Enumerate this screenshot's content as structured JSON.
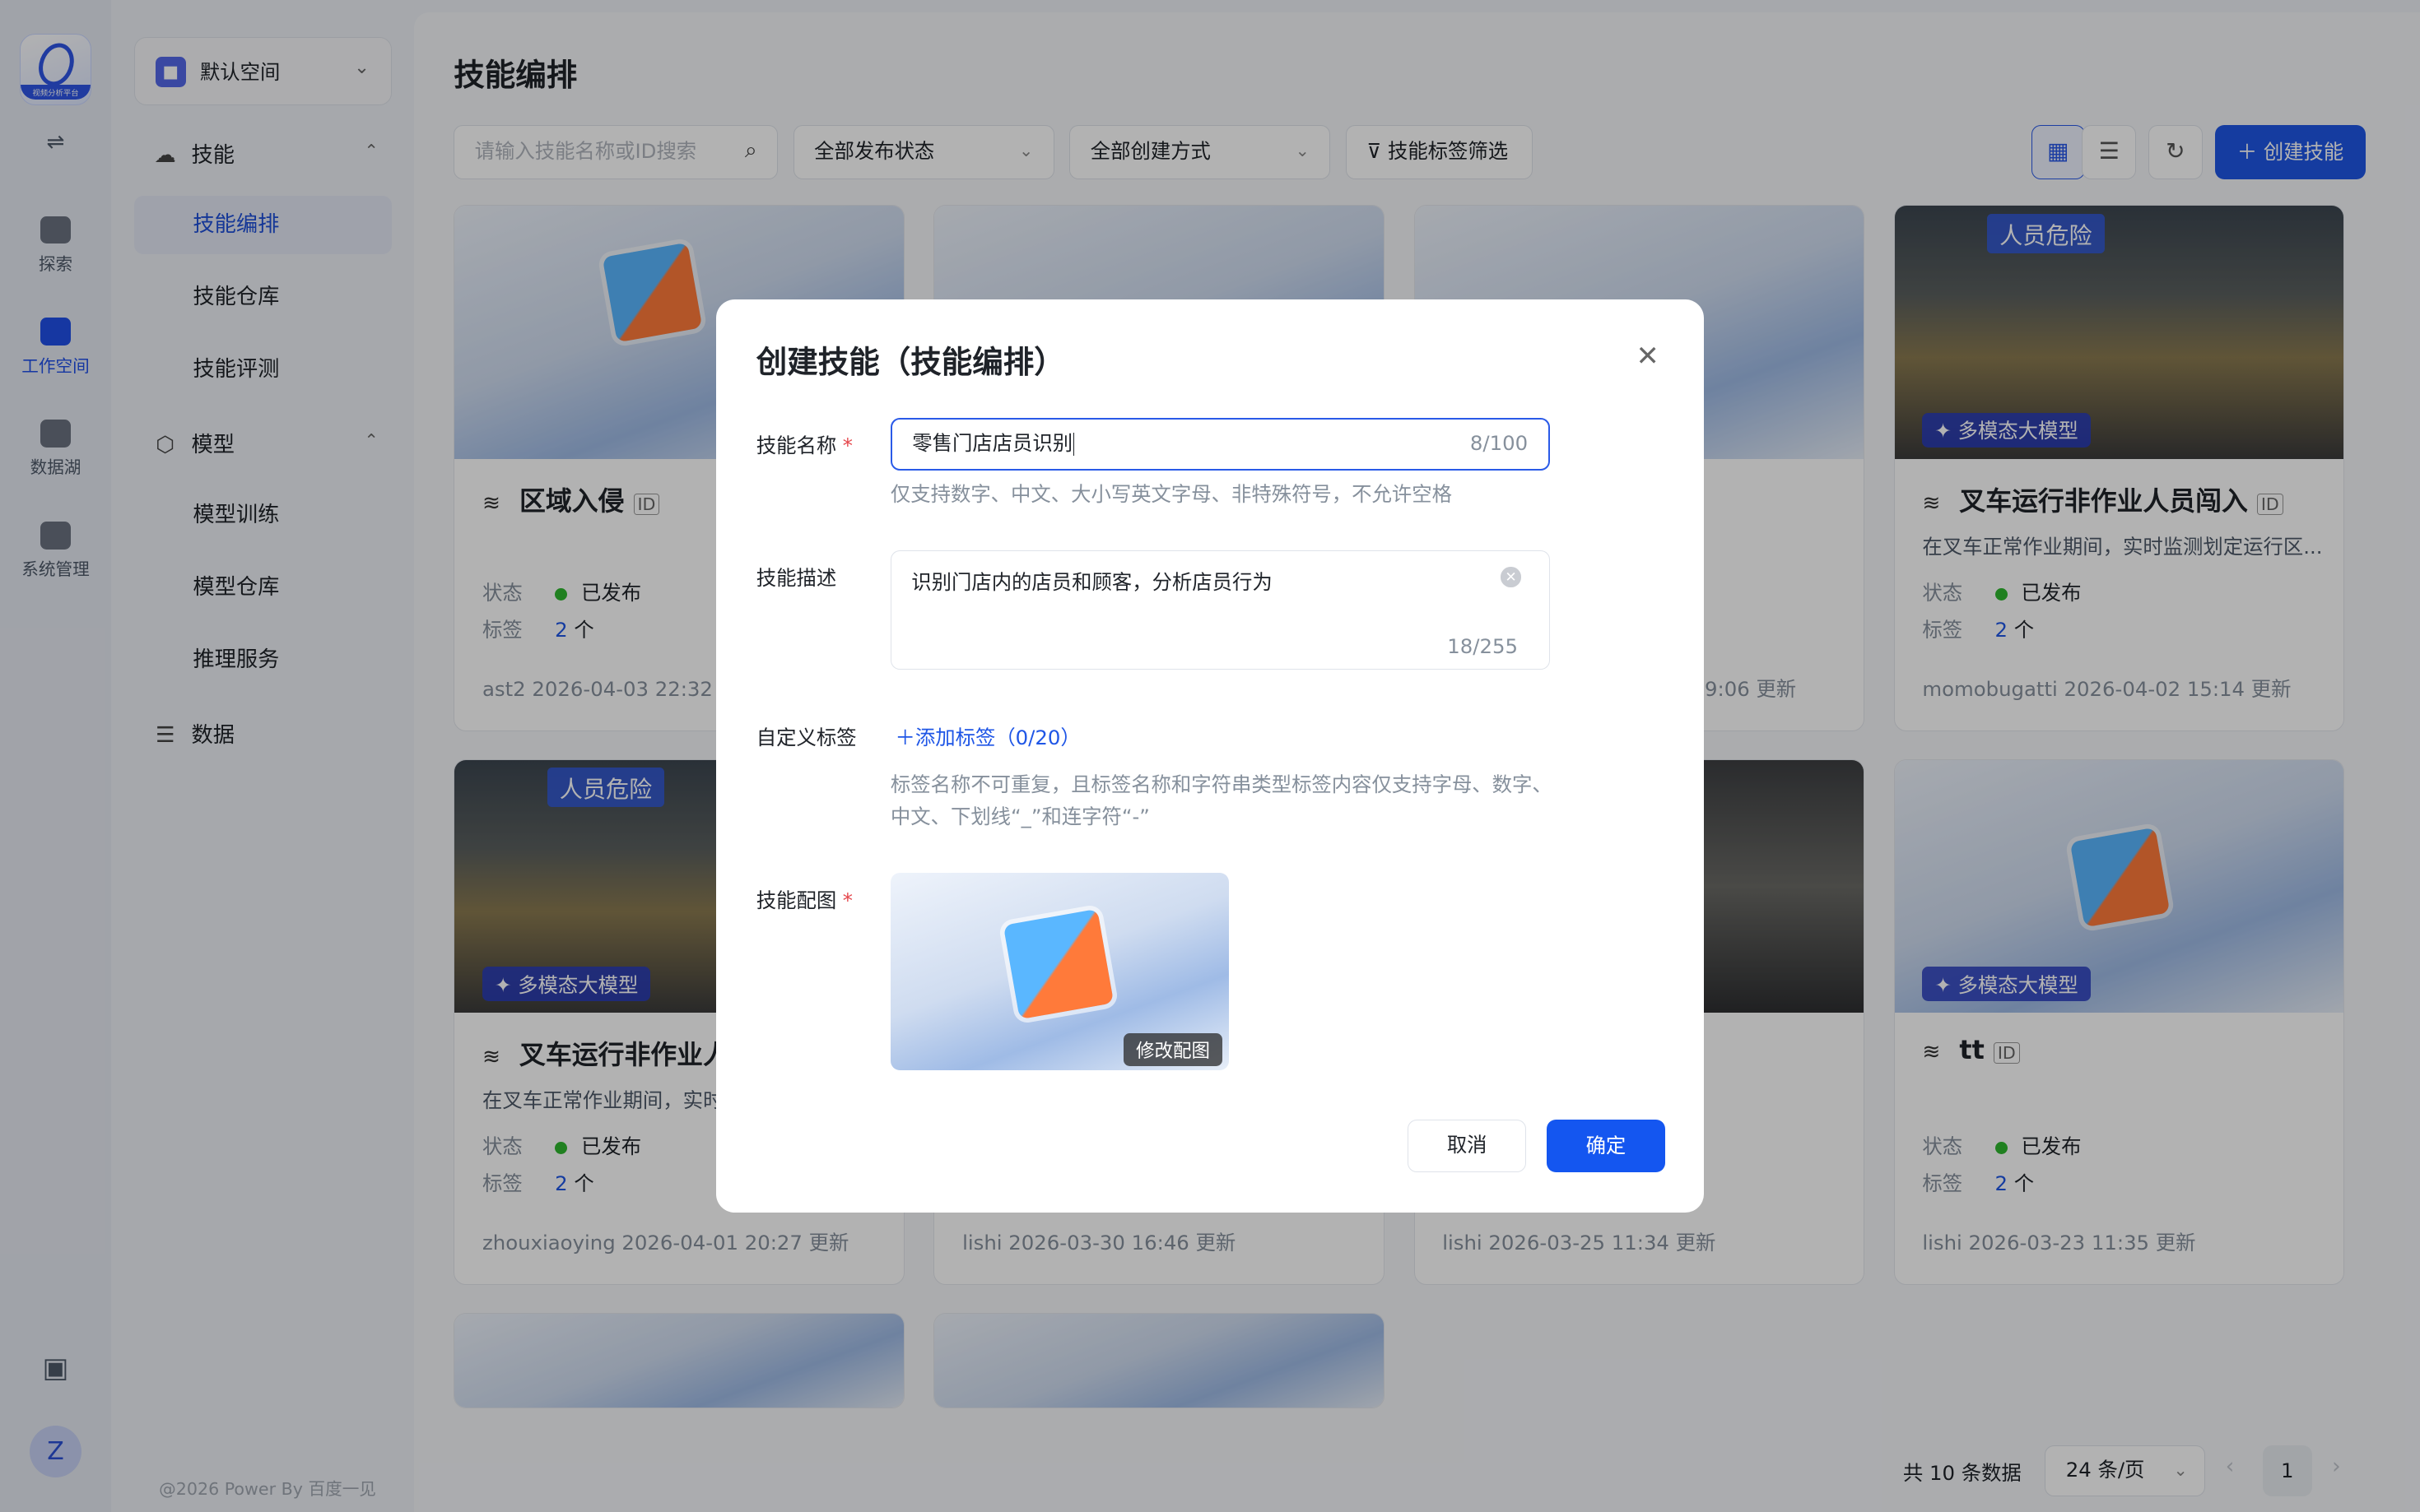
{
  "rail": {
    "logo_caption": "视频分析平台",
    "items": [
      {
        "label": "探索",
        "icon": "planet-icon"
      },
      {
        "label": "工作空间",
        "icon": "workspace-icon"
      },
      {
        "label": "数据湖",
        "icon": "database-icon"
      },
      {
        "label": "系统管理",
        "icon": "monitor-icon"
      }
    ],
    "avatar_letter": "Z"
  },
  "sidebar": {
    "workspace": "默认空间",
    "groups": [
      {
        "label": "技能",
        "items": [
          "技能编排",
          "技能仓库",
          "技能评测"
        ]
      },
      {
        "label": "模型",
        "items": [
          "模型训练",
          "模型仓库",
          "推理服务"
        ]
      },
      {
        "label": "数据",
        "items": []
      }
    ],
    "active_item": "技能编排",
    "footer": "@2026 Power By 百度一见"
  },
  "main": {
    "title": "技能编排",
    "search_placeholder": "请输入技能名称或ID搜索",
    "filter_status": "全部发布状态",
    "filter_method": "全部创建方式",
    "filter_tags": "技能标签筛选",
    "create_button": "创建技能"
  },
  "cards": [
    {
      "title": "区域入侵",
      "status_label": "状态",
      "status": "已发布",
      "tag_label": "标签",
      "tag_count": "2",
      "tag_unit": "个",
      "meta": "ast2 2026-04-03 22:32 更新"
    },
    {
      "title": "",
      "meta": ""
    },
    {
      "title": "",
      "meta": "9:06 更新"
    },
    {
      "title": "叉车运行非作业人员闯入",
      "desc": "在叉车正常作业期间，实时监测划定运行区...",
      "status_label": "状态",
      "status": "已发布",
      "tag_label": "标签",
      "tag_count": "2",
      "tag_unit": "个",
      "meta": "momobugatti 2026-04-02 15:14 更新",
      "badge": "多模态大模型",
      "danger": "人员危险"
    },
    {
      "title": "叉车运行非作业人",
      "desc": "在叉车正常作业期间，实时",
      "status_label": "状态",
      "status": "已发布",
      "tag_label": "标签",
      "tag_count": "2",
      "tag_unit": "个",
      "meta": "zhouxiaoying 2026-04-01 20:27 更新",
      "badge": "多模态大模型",
      "danger": "人员危险"
    },
    {
      "title": "",
      "meta": "lishi 2026-03-30 16:46 更新"
    },
    {
      "title": "",
      "meta": "lishi 2026-03-25 11:34 更新"
    },
    {
      "title": "tt",
      "status_label": "状态",
      "status": "已发布",
      "tag_label": "标签",
      "tag_count": "2",
      "tag_unit": "个",
      "meta": "lishi 2026-03-23 11:35 更新",
      "badge": "多模态大模型"
    }
  ],
  "pagination": {
    "total": "共 10 条数据",
    "page_size": "24 条/页",
    "current": "1"
  },
  "modal": {
    "title": "创建技能（技能编排）",
    "name_label": "技能名称",
    "name_value": "零售门店店员识别",
    "name_count": "8/100",
    "name_hint": "仅支持数字、中文、大小写英文字母、非特殊符号，不允许空格",
    "desc_label": "技能描述",
    "desc_value": "识别门店内的店员和顾客，分析店员行为",
    "desc_count": "18/255",
    "tag_label": "自定义标签",
    "add_tag": "添加标签（0/20）",
    "tag_hint": "标签名称不可重复，且标签名称和字符串类型标签内容仅支持字母、数字、中文、下划线“_”和连字符“-”",
    "image_label": "技能配图",
    "change_image": "修改配图",
    "cancel": "取消",
    "confirm": "确定"
  },
  "colors": {
    "primary": "#1f56e6",
    "published": "#2eb82e",
    "required": "#e5484d"
  }
}
